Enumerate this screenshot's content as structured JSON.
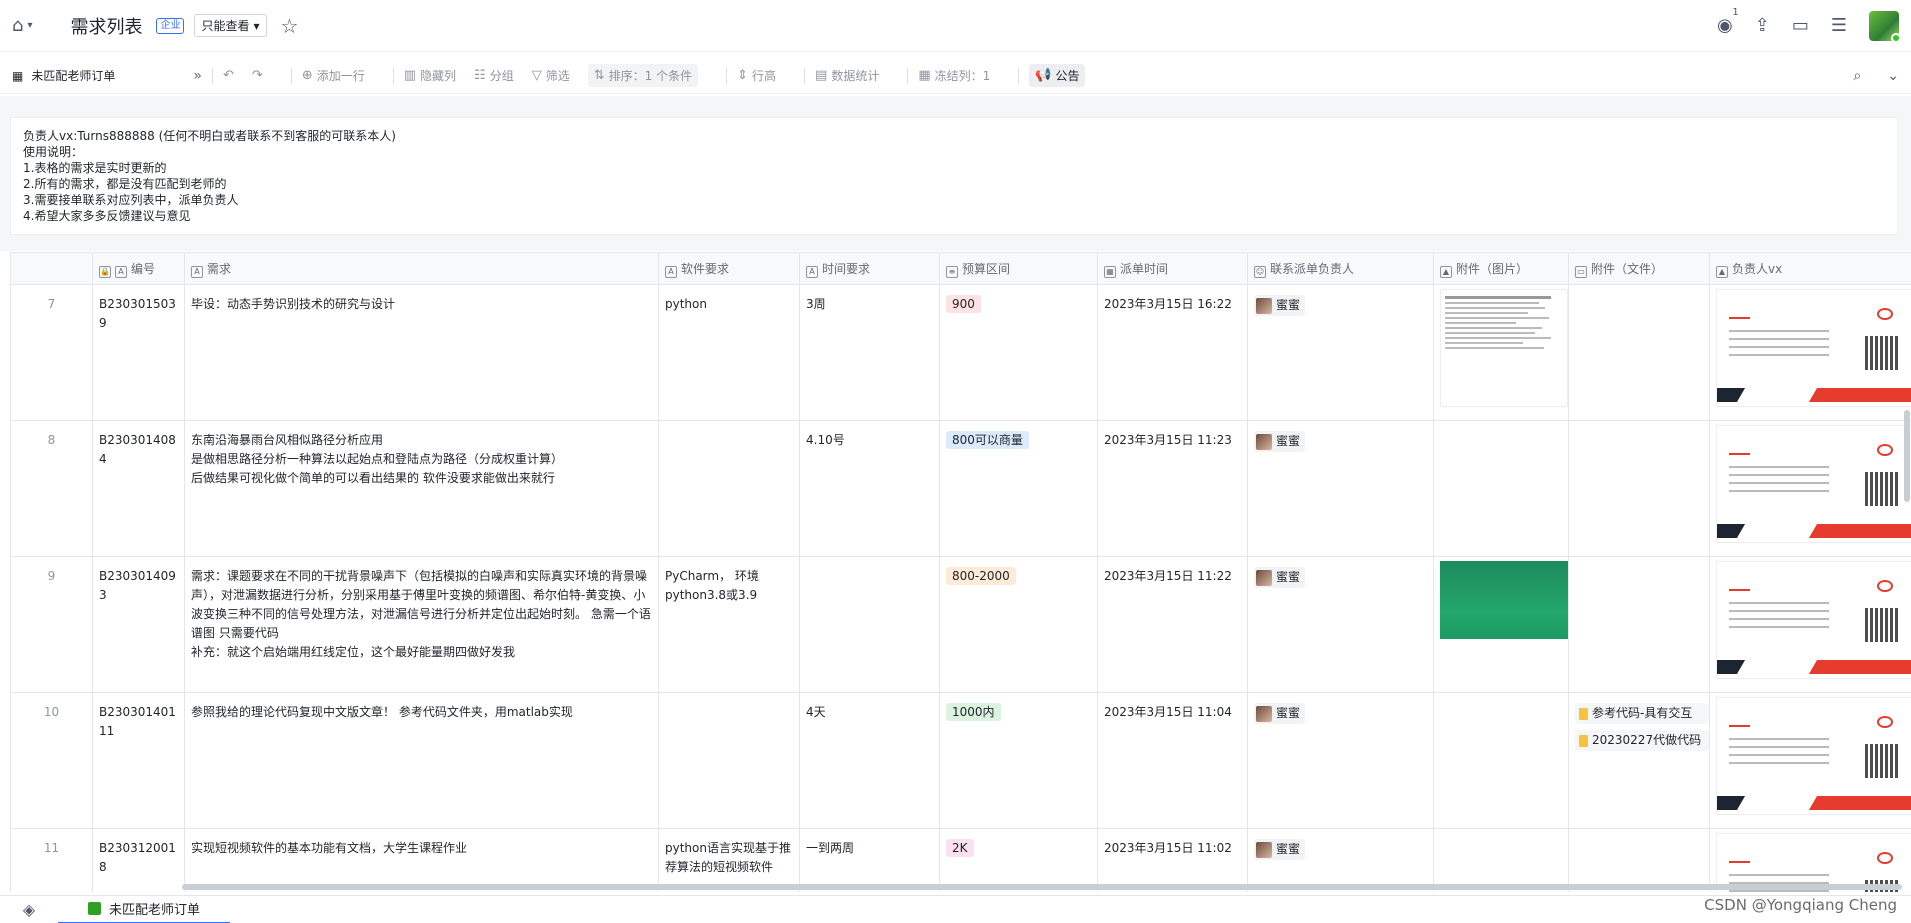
{
  "topbar": {
    "title": "需求列表",
    "badge": "企业",
    "permission": "只能查看",
    "viewer_count": "1"
  },
  "toolbar": {
    "view_name": "未匹配老师订单",
    "add_row": "添加一行",
    "hide_cols": "隐藏列",
    "group": "分组",
    "filter": "筛选",
    "sort": "排序：1 个条件",
    "row_height": "行高",
    "stats": "数据统计",
    "freeze": "冻结列：1",
    "notice": "公告"
  },
  "notice": {
    "lines": [
      "负责人vx:Turns888888 (任何不明白或者联系不到客服的可联系本人)",
      "使用说明：",
      "1.表格的需求是实时更新的",
      "2.所有的需求，都是没有匹配到老师的",
      "3.需要接单联系对应列表中，派单负责人",
      "4.希望大家多多反馈建议与意见"
    ]
  },
  "columns": [
    "编号",
    "需求",
    "软件要求",
    "时间要求",
    "预算区间",
    "派单时间",
    "联系派单负责人",
    "附件（图片）",
    "附件（文件）",
    "负责人vx"
  ],
  "rows": [
    {
      "num": "7",
      "id": "B2303015039",
      "req": [
        "毕设：动态手势识别技术的研究与设计"
      ],
      "software": "python",
      "time": "3周",
      "budget": "900",
      "budget_color": "#fde2e2",
      "dispatch": "2023年3月15日 16:22",
      "owner": "蜜蜜",
      "img": "doc",
      "files": []
    },
    {
      "num": "8",
      "id": "B2303014084",
      "req": [
        "东南沿海暴雨台风相似路径分析应用",
        "是做相思路径分析一种算法以起始点和登陆点为路径（分成权重计算）",
        "后做结果可视化做个简单的可以看出结果的 软件没要求能做出来就行"
      ],
      "software": "",
      "time": "4.10号",
      "budget": "800可以商量",
      "budget_color": "#dbeafd",
      "dispatch": "2023年3月15日 11:23",
      "owner": "蜜蜜",
      "img": "",
      "files": []
    },
    {
      "num": "9",
      "id": "B2303014093",
      "req": [
        "需求：课题要求在不同的干扰背景噪声下（包括模拟的白噪声和实际真实环境的背景噪声），对泄漏数据进行分析，分别采用基于傅里叶变换的频谱图、希尔伯特-黄变换、小波变换三种不同的信号处理方法，对泄漏信号进行分析并定位出起始时刻。 急需一个语谱图 只需要代码",
        "补充：就这个启始端用红线定位，这个最好能量期四做好发我"
      ],
      "software": "PyCharm， 环境python3.8或3.9",
      "time": "",
      "budget": "800-2000",
      "budget_color": "#fdebd8",
      "dispatch": "2023年3月15日 11:22",
      "owner": "蜜蜜",
      "img": "spec",
      "files": []
    },
    {
      "num": "10",
      "id": "B23030140111",
      "req": [
        "参照我给的理论代码复现中文版文章！ 参考代码文件夹，用matlab实现"
      ],
      "software": "",
      "time": "4天",
      "budget": "1000内",
      "budget_color": "#dcf3e0",
      "dispatch": "2023年3月15日 11:04",
      "owner": "蜜蜜",
      "img": "",
      "files": [
        "参考代码-具有交互",
        "20230227代做代码"
      ]
    },
    {
      "num": "11",
      "id": "B2303120018",
      "req": [
        "实现短视频软件的基本功能有文档，大学生课程作业"
      ],
      "software": "python语言实现基于推荐算法的短视频软件",
      "time": "一到两周",
      "budget": "2K",
      "budget_color": "#fbe0ef",
      "dispatch": "2023年3月15日 11:02",
      "owner": "蜜蜜",
      "img": "",
      "files": []
    }
  ],
  "bottom": {
    "sheet": "未匹配老师订单",
    "csdn": "CSDN @Yongqiang Cheng"
  }
}
